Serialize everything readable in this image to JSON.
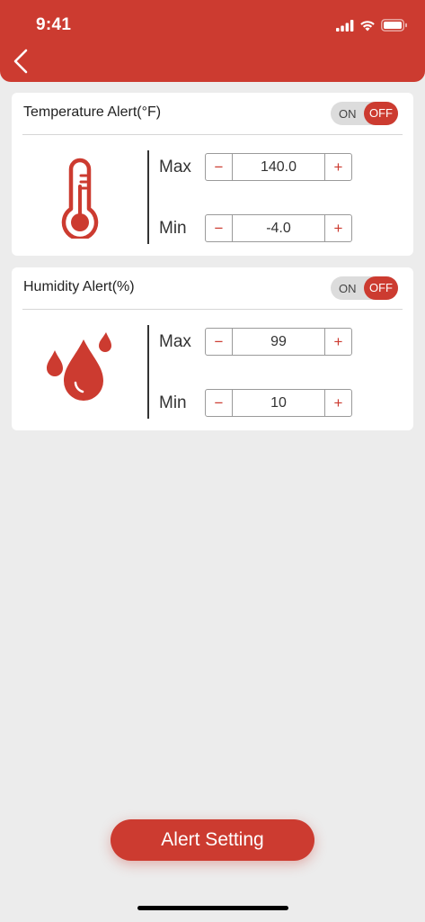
{
  "status_bar": {
    "time": "9:41"
  },
  "colors": {
    "accent": "#cc3b30",
    "background": "#ececec"
  },
  "temperature": {
    "title": "Temperature Alert(°F)",
    "toggle": {
      "on_label": "ON",
      "off_label": "OFF",
      "state": "OFF"
    },
    "max_label": "Max",
    "max_value": "140.0",
    "min_label": "Min",
    "min_value": "-4.0",
    "icon": "thermometer-icon"
  },
  "humidity": {
    "title": "Humidity Alert(%)",
    "toggle": {
      "on_label": "ON",
      "off_label": "OFF",
      "state": "OFF"
    },
    "max_label": "Max",
    "max_value": "99",
    "min_label": "Min",
    "min_value": "10",
    "icon": "water-drops-icon"
  },
  "stepper": {
    "minus": "−",
    "plus": "+"
  },
  "footer": {
    "alert_setting_label": "Alert Setting"
  }
}
